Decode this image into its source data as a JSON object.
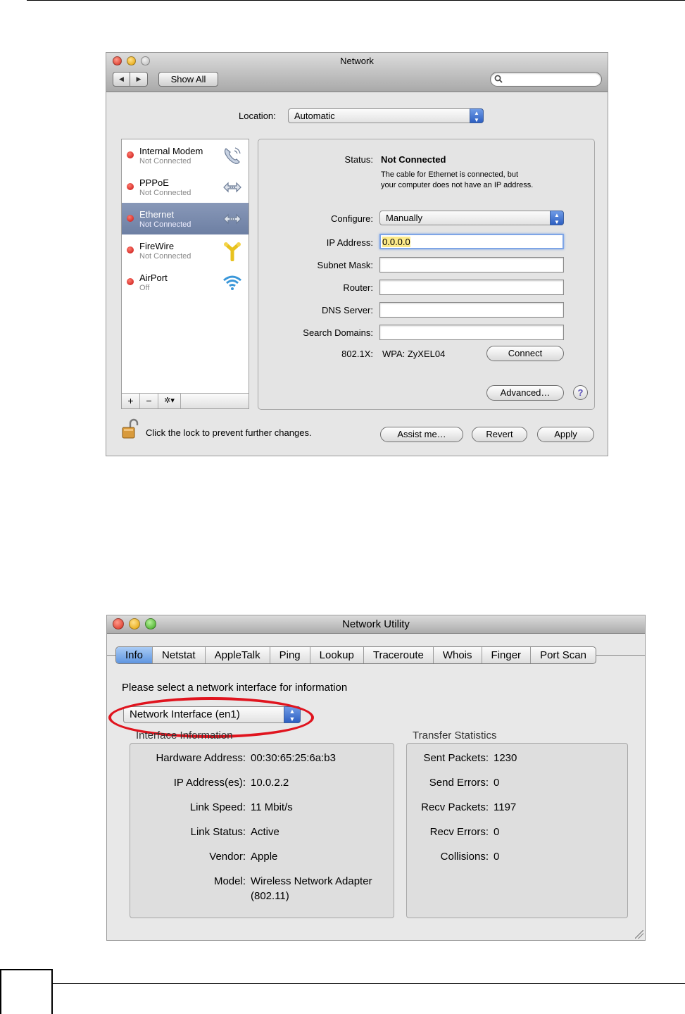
{
  "network_window": {
    "title": "Network",
    "toolbar": {
      "back_glyph": "◀",
      "forward_glyph": "▶",
      "show_all": "Show All",
      "search_placeholder": ""
    },
    "location": {
      "label": "Location:",
      "value": "Automatic"
    },
    "services": [
      {
        "name": "Internal Modem",
        "status": "Not Connected",
        "icon": "phone-icon",
        "selected": false
      },
      {
        "name": "PPPoE",
        "status": "Not Connected",
        "icon": "network-arrows-icon",
        "selected": false
      },
      {
        "name": "Ethernet",
        "status": "Not Connected",
        "icon": "network-arrows-icon",
        "selected": true
      },
      {
        "name": "FireWire",
        "status": "Not Connected",
        "icon": "firewire-icon",
        "selected": false
      },
      {
        "name": "AirPort",
        "status": "Off",
        "icon": "wifi-icon",
        "selected": false
      }
    ],
    "list_tools": {
      "add": "+",
      "remove": "−",
      "gear": "✲▾"
    },
    "detail": {
      "status_label": "Status:",
      "status_value": "Not Connected",
      "status_desc_1": "The cable for Ethernet is connected, but",
      "status_desc_2": "your computer does not have an IP address.",
      "configure_label": "Configure:",
      "configure_value": "Manually",
      "ip_label": "IP Address:",
      "ip_value": "0.0.0.0",
      "subnet_label": "Subnet Mask:",
      "subnet_value": "",
      "router_label": "Router:",
      "router_value": "",
      "dns_label": "DNS Server:",
      "dns_value": "",
      "search_domains_label": "Search Domains:",
      "search_domains_value": "",
      "dot1x_label": "802.1X:",
      "dot1x_value": "WPA: ZyXEL04",
      "connect_button": "Connect",
      "advanced_button": "Advanced…",
      "help_button": "?"
    },
    "footer": {
      "lock_text": "Click the lock to prevent further changes.",
      "assist_button": "Assist me…",
      "revert_button": "Revert",
      "apply_button": "Apply"
    }
  },
  "utility_window": {
    "title": "Network Utility",
    "tabs": [
      "Info",
      "Netstat",
      "AppleTalk",
      "Ping",
      "Lookup",
      "Traceroute",
      "Whois",
      "Finger",
      "Port Scan"
    ],
    "active_tab": "Info",
    "prompt": "Please select a network interface for information",
    "interface_value": "Network Interface (en1)",
    "interface_info": {
      "title": "Interface Information",
      "rows": [
        {
          "label": "Hardware Address:",
          "value": "00:30:65:25:6a:b3"
        },
        {
          "label": "IP Address(es):",
          "value": "10.0.2.2"
        },
        {
          "label": "Link Speed:",
          "value": "11 Mbit/s"
        },
        {
          "label": "Link Status:",
          "value": "Active"
        },
        {
          "label": "Vendor:",
          "value": "Apple"
        },
        {
          "label": "Model:",
          "value": "Wireless Network Adapter",
          "value2": "(802.11)"
        }
      ]
    },
    "transfer_stats": {
      "title": "Transfer Statistics",
      "rows": [
        {
          "label": "Sent Packets:",
          "value": "1230"
        },
        {
          "label": "Send Errors:",
          "value": "0"
        },
        {
          "label": "Recv Packets:",
          "value": "1197"
        },
        {
          "label": "Recv Errors:",
          "value": "0"
        },
        {
          "label": "Collisions:",
          "value": "0"
        }
      ]
    },
    "annotation_color": "#e0141e"
  }
}
